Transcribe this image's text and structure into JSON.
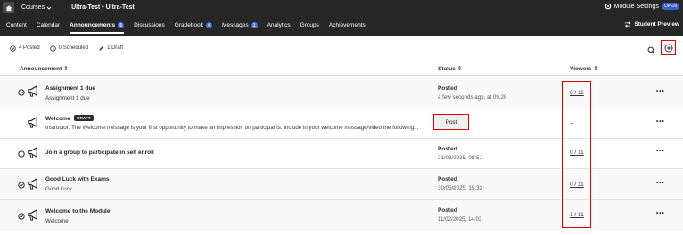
{
  "topbar": {
    "courses_label": "Courses",
    "course_title": "Ultra-Test • Ultra-Test",
    "module_settings_label": "Module Settings",
    "module_settings_badge": "OPEN"
  },
  "nav": {
    "items": [
      {
        "label": "Content",
        "count": ""
      },
      {
        "label": "Calendar",
        "count": ""
      },
      {
        "label": "Announcements",
        "count": "5"
      },
      {
        "label": "Discussions",
        "count": ""
      },
      {
        "label": "Gradebook",
        "count": "4"
      },
      {
        "label": "Messages",
        "count": "1"
      },
      {
        "label": "Analytics",
        "count": ""
      },
      {
        "label": "Groups",
        "count": ""
      },
      {
        "label": "Achievements",
        "count": ""
      }
    ],
    "active": "Announcements",
    "student_preview_label": "Student Preview"
  },
  "stats": {
    "posted": "4 Posted",
    "scheduled": "0 Scheduled",
    "draft": "1 Draft"
  },
  "table": {
    "headers": {
      "announcement": "Announcement",
      "status": "Status",
      "viewers": "Viewers"
    },
    "rows": [
      {
        "title": "Assignment 1 due",
        "subtitle": "Assignment 1 due",
        "status": "Posted",
        "date": "a few seconds ago, at 09.20",
        "viewers": "0 / 11",
        "badge": ""
      },
      {
        "title": "Welcome",
        "subtitle": "Instructor: The Welcome message is your first opportunity to make an impression on participants. Include in your welcome message/video the following...",
        "status": "",
        "date": "",
        "viewers": "--",
        "badge": "DRAFT",
        "action": "Post"
      },
      {
        "title": "Join a group to participate in self enroll",
        "subtitle": "",
        "status": "Posted",
        "date": "21/08/2025, 08:51",
        "viewers": "0 / 11",
        "badge": ""
      },
      {
        "title": "Good Luck with Exams",
        "subtitle": "Good Luck",
        "status": "Posted",
        "date": "30/05/2025, 15:33",
        "viewers": "0 / 11",
        "badge": ""
      },
      {
        "title": "Welcome to the Module",
        "subtitle": "Welcome",
        "status": "Posted",
        "date": "11/02/2025, 14:03",
        "viewers": "1 / 11",
        "badge": ""
      }
    ]
  },
  "more_label": "•••"
}
